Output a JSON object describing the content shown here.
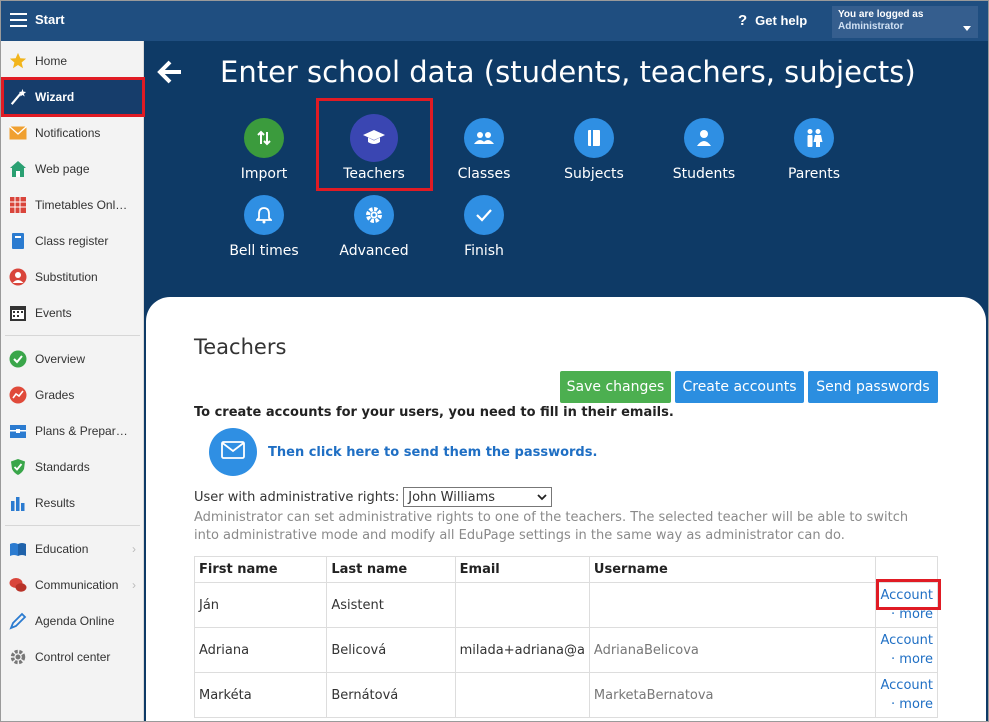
{
  "topbar": {
    "start_label": "Start",
    "help_label": "Get help",
    "help_icon": "?",
    "login_line1": "You are logged as",
    "login_line2": "Administrator"
  },
  "sidebar": {
    "items": [
      {
        "label": "Home",
        "icon": "star-icon"
      },
      {
        "label": "Wizard",
        "icon": "magic-wand-icon"
      },
      {
        "label": "Notifications",
        "icon": "envelope-icon"
      },
      {
        "label": "Web page",
        "icon": "house-icon"
      },
      {
        "label": "Timetables Onl…",
        "icon": "grid-icon"
      },
      {
        "label": "Class register",
        "icon": "book-icon"
      },
      {
        "label": "Substitution",
        "icon": "person-icon"
      },
      {
        "label": "Events",
        "icon": "calendar-icon"
      },
      {
        "label": "Overview",
        "icon": "check-circle-icon"
      },
      {
        "label": "Grades",
        "icon": "chart-circle-icon"
      },
      {
        "label": "Plans & Prepar…",
        "icon": "folder-icon"
      },
      {
        "label": "Standards",
        "icon": "shield-check-icon"
      },
      {
        "label": "Results",
        "icon": "bars-icon"
      },
      {
        "label": "Education",
        "icon": "open-book-icon"
      },
      {
        "label": "Communication",
        "icon": "chat-icon"
      },
      {
        "label": "Agenda Online",
        "icon": "pencil-icon"
      },
      {
        "label": "Control center",
        "icon": "gear-icon"
      }
    ]
  },
  "header": {
    "title": "Enter school data (students, teachers, subjects)"
  },
  "steps": [
    {
      "label": "Import"
    },
    {
      "label": "Teachers"
    },
    {
      "label": "Classes"
    },
    {
      "label": "Subjects"
    },
    {
      "label": "Students"
    },
    {
      "label": "Parents"
    },
    {
      "label": "Bell times"
    },
    {
      "label": "Advanced"
    },
    {
      "label": "Finish"
    }
  ],
  "content": {
    "section_title": "Teachers",
    "save_label": "Save changes",
    "create_label": "Create accounts",
    "send_label": "Send passwords",
    "instruction": "To create accounts for your users, you need to fill in their emails.",
    "send_link": "Then click here to send them the passwords.",
    "admin_label": "User with administrative rights:",
    "admin_value": "John Williams",
    "admin_note": "Administrator can set administrative rights to one of the teachers. The selected teacher will be able to switch into administrative mode and modify all EduPage settings in the same way as administrator can do."
  },
  "table": {
    "headers": [
      "First name",
      "Last name",
      "Email",
      "Username",
      ""
    ],
    "account_label": "Account",
    "more_label": "· more",
    "rows": [
      {
        "first": "Ján",
        "last": "Asistent",
        "email": "",
        "username": ""
      },
      {
        "first": "Adriana",
        "last": "Belicová",
        "email": "milada+adriana@a",
        "username": "AdrianaBelicova"
      },
      {
        "first": "Markéta",
        "last": "Bernátová",
        "email": "",
        "username": "MarketaBernatova"
      }
    ]
  }
}
